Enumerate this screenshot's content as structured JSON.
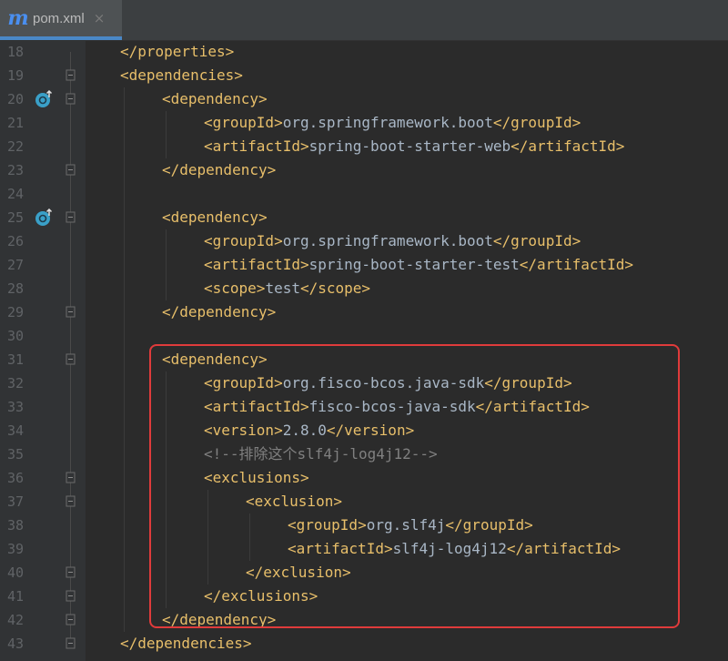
{
  "tab": {
    "icon": "maven-m-icon",
    "label": "pom.xml",
    "close": "×"
  },
  "lines": [
    {
      "n": "18",
      "indent": 0,
      "parts": [
        [
          "tag",
          "</properties>"
        ]
      ]
    },
    {
      "n": "19",
      "indent": 0,
      "parts": [
        [
          "tag",
          "<dependencies>"
        ]
      ]
    },
    {
      "n": "20",
      "indent": 1,
      "parts": [
        [
          "tag",
          "<dependency>"
        ]
      ]
    },
    {
      "n": "21",
      "indent": 2,
      "parts": [
        [
          "tag",
          "<groupId>"
        ],
        [
          "text",
          "org.springframework.boot"
        ],
        [
          "tag",
          "</groupId>"
        ]
      ]
    },
    {
      "n": "22",
      "indent": 2,
      "parts": [
        [
          "tag",
          "<artifactId>"
        ],
        [
          "text",
          "spring-boot-starter-web"
        ],
        [
          "tag",
          "</artifactId>"
        ]
      ]
    },
    {
      "n": "23",
      "indent": 1,
      "parts": [
        [
          "tag",
          "</dependency>"
        ]
      ]
    },
    {
      "n": "24",
      "indent": 0,
      "parts": []
    },
    {
      "n": "25",
      "indent": 1,
      "parts": [
        [
          "tag",
          "<dependency>"
        ]
      ]
    },
    {
      "n": "26",
      "indent": 2,
      "parts": [
        [
          "tag",
          "<groupId>"
        ],
        [
          "text",
          "org.springframework.boot"
        ],
        [
          "tag",
          "</groupId>"
        ]
      ]
    },
    {
      "n": "27",
      "indent": 2,
      "parts": [
        [
          "tag",
          "<artifactId>"
        ],
        [
          "text",
          "spring-boot-starter-test"
        ],
        [
          "tag",
          "</artifactId>"
        ]
      ]
    },
    {
      "n": "28",
      "indent": 2,
      "parts": [
        [
          "tag",
          "<scope>"
        ],
        [
          "text",
          "test"
        ],
        [
          "tag",
          "</scope>"
        ]
      ]
    },
    {
      "n": "29",
      "indent": 1,
      "parts": [
        [
          "tag",
          "</dependency>"
        ]
      ]
    },
    {
      "n": "30",
      "indent": 0,
      "parts": []
    },
    {
      "n": "31",
      "indent": 1,
      "parts": [
        [
          "tag",
          "<dependency>"
        ]
      ]
    },
    {
      "n": "32",
      "indent": 2,
      "parts": [
        [
          "tag",
          "<groupId>"
        ],
        [
          "text",
          "org.fisco-bcos.java-sdk"
        ],
        [
          "tag",
          "</groupId>"
        ]
      ]
    },
    {
      "n": "33",
      "indent": 2,
      "parts": [
        [
          "tag",
          "<artifactId>"
        ],
        [
          "text",
          "fisco-bcos-java-sdk"
        ],
        [
          "tag",
          "</artifactId>"
        ]
      ]
    },
    {
      "n": "34",
      "indent": 2,
      "parts": [
        [
          "tag",
          "<version>"
        ],
        [
          "text",
          "2.8.0"
        ],
        [
          "tag",
          "</version>"
        ]
      ]
    },
    {
      "n": "35",
      "indent": 2,
      "parts": [
        [
          "comment",
          "<!--排除这个slf4j-log4j12-->"
        ]
      ]
    },
    {
      "n": "36",
      "indent": 2,
      "parts": [
        [
          "tag",
          "<exclusions>"
        ]
      ]
    },
    {
      "n": "37",
      "indent": 3,
      "parts": [
        [
          "tag",
          "<exclusion>"
        ]
      ]
    },
    {
      "n": "38",
      "indent": 4,
      "parts": [
        [
          "tag",
          "<groupId>"
        ],
        [
          "text",
          "org.slf4j"
        ],
        [
          "tag",
          "</groupId>"
        ]
      ]
    },
    {
      "n": "39",
      "indent": 4,
      "parts": [
        [
          "tag",
          "<artifactId>"
        ],
        [
          "text",
          "slf4j-log4j12"
        ],
        [
          "tag",
          "</artifactId>"
        ]
      ]
    },
    {
      "n": "40",
      "indent": 3,
      "parts": [
        [
          "tag",
          "</exclusion>"
        ]
      ]
    },
    {
      "n": "41",
      "indent": 2,
      "parts": [
        [
          "tag",
          "</exclusions>"
        ]
      ]
    },
    {
      "n": "42",
      "indent": 1,
      "parts": [
        [
          "tag",
          "</dependency>"
        ]
      ]
    },
    {
      "n": "43",
      "indent": 0,
      "parts": [
        [
          "tag",
          "</dependencies>"
        ]
      ]
    }
  ],
  "gutter_markers": [
    {
      "line": "20",
      "icon": "maven-dependency-up-icon"
    },
    {
      "line": "25",
      "icon": "maven-dependency-up-icon"
    }
  ],
  "fold_markers": [
    "19",
    "20",
    "23",
    "25",
    "29",
    "31",
    "36",
    "37",
    "40",
    "41",
    "42",
    "43"
  ],
  "highlight": {
    "from_line": "31",
    "to_line": "42",
    "color": "#e03b3b"
  },
  "colors": {
    "tag": "#e8bf6a",
    "text": "#a9b7c6",
    "comment": "#808080",
    "line_number": "#606366",
    "background": "#2b2b2b"
  }
}
